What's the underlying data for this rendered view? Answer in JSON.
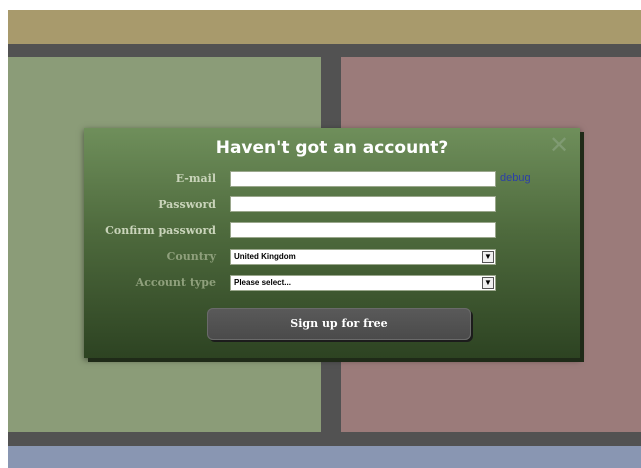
{
  "modal": {
    "title": "Haven't got an account?",
    "close_symbol": "✕"
  },
  "fields": {
    "email_label": "E-mail",
    "email_value": "",
    "password_label": "Password",
    "password_value": "",
    "confirm_password_label": "Confirm password",
    "confirm_password_value": "",
    "country_label": "Country",
    "country_selected": "United Kingdom",
    "account_type_label": "Account type",
    "account_type_selected": "Please select..."
  },
  "debug_link": "debug",
  "submit_button": "Sign up for free",
  "icons": {
    "close": "close-icon",
    "dropdown": "chevron-down-icon"
  },
  "colors": {
    "top_bar": "#a89a6c",
    "left_panel": "#8b9c78",
    "right_panel": "#9b7b7a",
    "bottom_bar": "#8996b2",
    "modal_top": "#6f8f5b",
    "modal_bottom": "#2d4322",
    "button": "#4f4f4f",
    "debug_link": "#2b3fa8"
  }
}
